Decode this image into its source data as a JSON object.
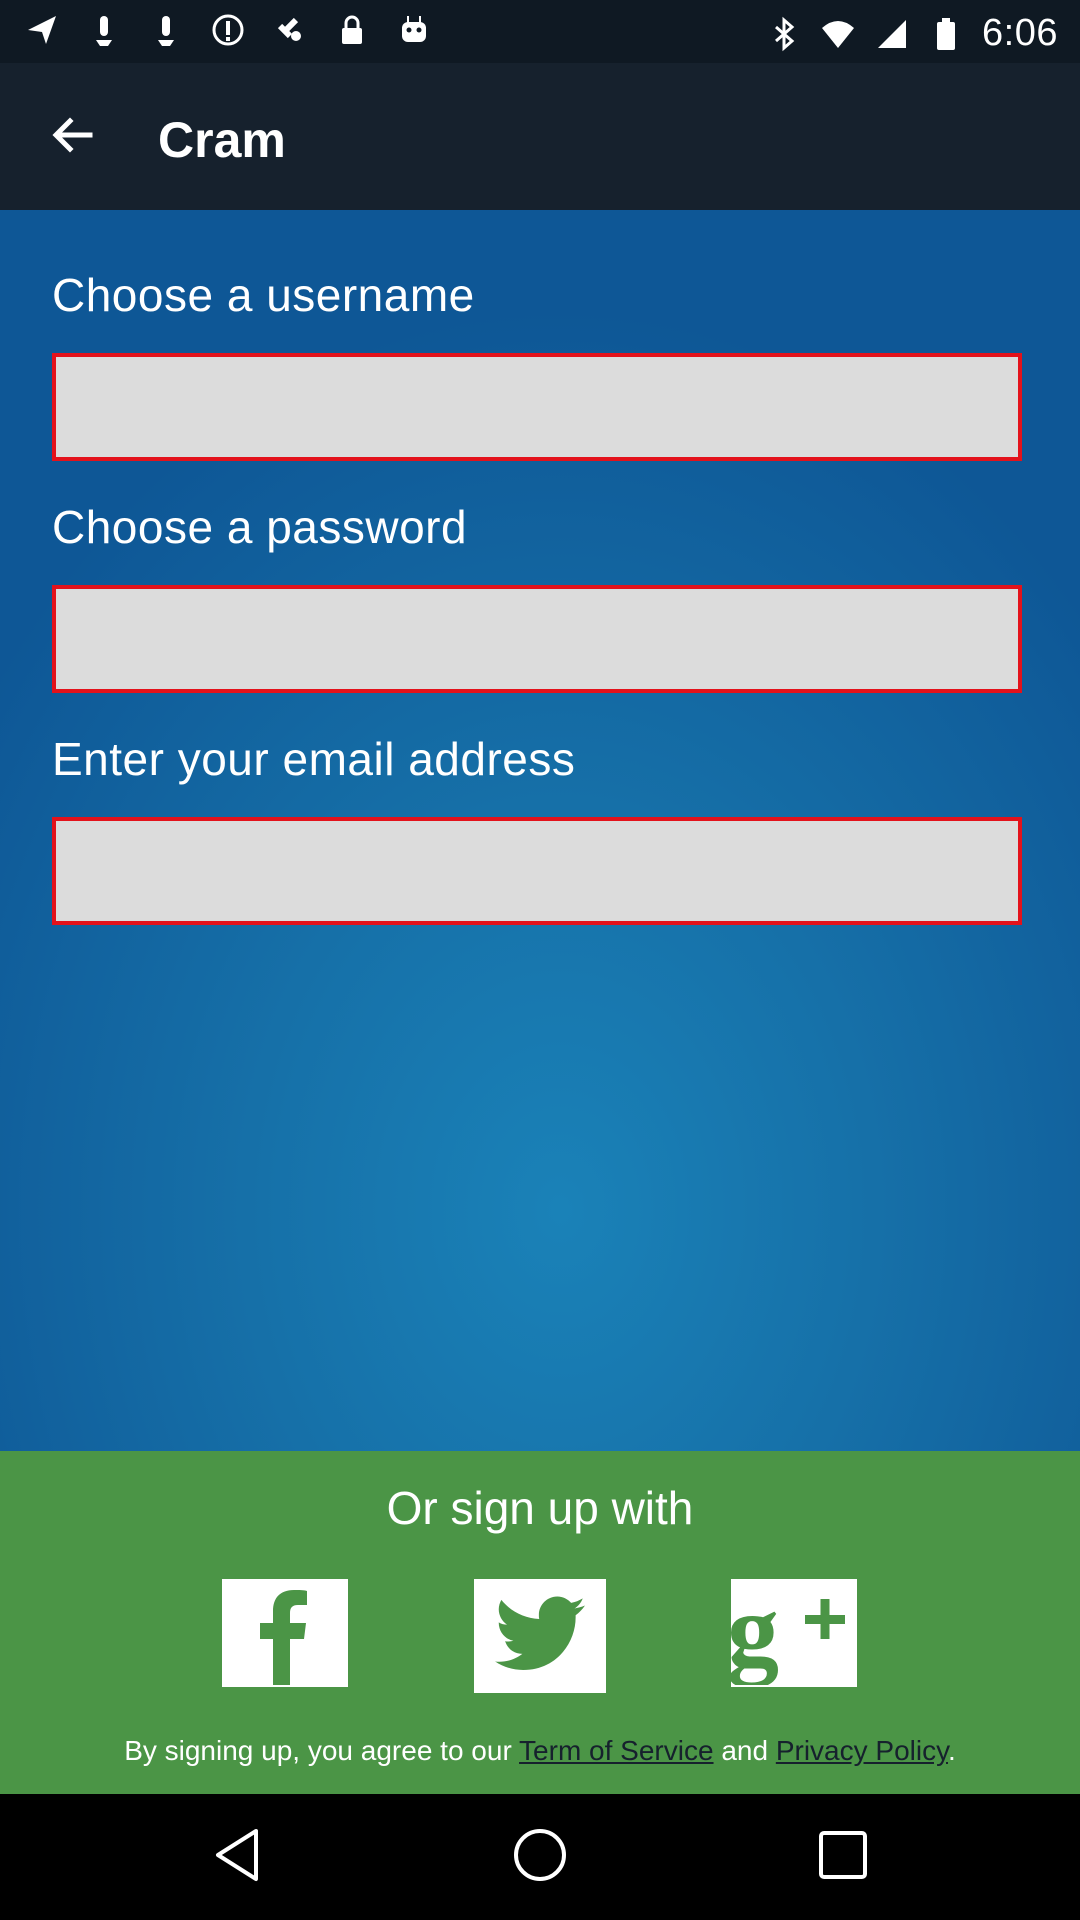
{
  "status_bar": {
    "time": "6:06",
    "left_icons": [
      "navigation-icon",
      "notification-icon",
      "notification-icon",
      "info-icon",
      "satellite-fake-icon",
      "lock-icon",
      "android-icon"
    ],
    "right_icons": [
      "bluetooth-icon",
      "wifi-icon",
      "signal-icon",
      "battery-icon"
    ]
  },
  "app_bar": {
    "title": "Cram",
    "back_icon": "arrow-left-icon"
  },
  "form": {
    "username": {
      "label": "Choose a username",
      "value": "",
      "placeholder": ""
    },
    "password": {
      "label": "Choose a password",
      "value": "",
      "placeholder": ""
    },
    "email": {
      "label": "Enter your email address",
      "value": "",
      "placeholder": ""
    },
    "field_border_color": "#e3121b",
    "field_fill_color": "#dcdcdc"
  },
  "social_signup": {
    "heading": "Or sign up with",
    "buttons": [
      {
        "icon": "facebook-icon"
      },
      {
        "icon": "twitter-icon"
      },
      {
        "icon": "google-plus-icon"
      }
    ],
    "panel_color": "#4b9546"
  },
  "terms": {
    "prefix": "By signing up, you agree to our ",
    "tos_link": "Term of Service",
    "middle": " and ",
    "privacy_link": "Privacy Policy",
    "suffix": "."
  },
  "nav_bar": {
    "buttons": [
      "back-triangle-icon",
      "home-circle-icon",
      "recents-square-icon"
    ]
  }
}
